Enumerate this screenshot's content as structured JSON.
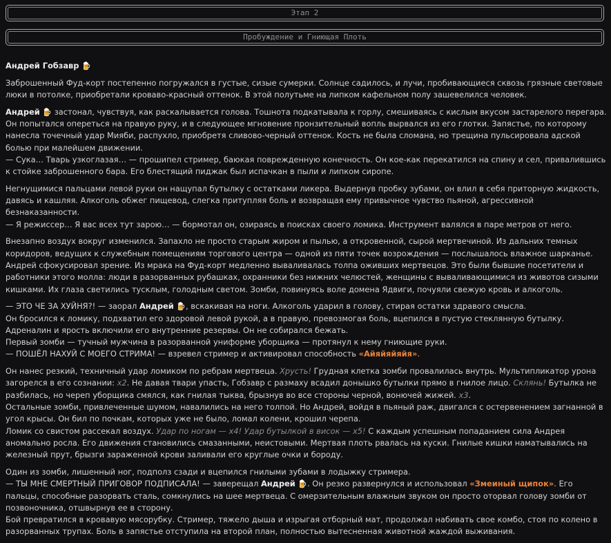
{
  "header": {
    "stage": "Этап 2",
    "chapter": "Пробуждение и Гниющая Плоть"
  },
  "author": {
    "name": "Андрей Гобзавр",
    "emoji": "🍺"
  },
  "hero": {
    "name": "Андрей",
    "emoji": "🍺"
  },
  "story": {
    "p1": "Заброшенный Фуд-корт постепенно погружался в густые, сизые сумерки. Солнце садилось, и лучи, пробивающиеся сквозь грязные световые люки в потолке, приобретали кроваво-красный оттенок. В этой полутьме на липком кафельном полу зашевелился человек.",
    "p2a": " застонал, чувствуя, как раскалывается голова. Тошнота подкатывала к горлу, смешиваясь с кислым вкусом застарелого перегара. Он попытался опереться на правую руку, и в следующее мгновение пронзительный вопль вырвался из его глотки. Запястье, по которому нанесла точечный удар Мияби, распухло, приобретя сливово-черный оттенок. Кость не была сломана, но трещина пульсировала адской болью при малейшем движении.",
    "p2b": "— Сука… Тварь узкоглазая… — прошипел стример, баюкая поврежденную конечность. Он кое-как перекатился на спину и сел, привалившись к стойке заброшенного бара. Его блестящий пиджак был испачкан в пыли и липком сиропе.",
    "p3a": "Негнущимися пальцами левой руки он нащупал бутылку с остатками ликера. Выдернув пробку зубами, он влил в себя приторную жидкость, давясь и кашляя. Алкоголь обжег пищевод, слегка притупляя боль и возвращая ему привычное чувство пьяной, агрессивной безнаказанности.",
    "p3b": "— Я режиссер… Я вас всех тут зарою… — бормотал он, озираясь в поисках своего ломика. Инструмент валялся в паре метров от него.",
    "p4a": "Внезапно воздух вокруг изменился. Запахло не просто старым жиром и пылью, а откровенной, сырой мертвечиной. Из дальних темных коридоров, ведущих к служебным помещениям торгового центра — одной из пяти точек возрождения — послышалось влажное шарканье.",
    "p4b": "Андрей сфокусировал зрение. Из мрака на Фуд-корт медленно вываливалась толпа оживших мертвецов. Это были бывшие посетители и работники этого молла: люди в разорванных рубашках, охранники без нижних челюстей, женщины с вываливающимися из животов сизыми кишками. Их глаза светились тусклым, голодным светом. Зомби, повинуясь воле домена Ядвиги, почуяли свежую кровь и алкоголь.",
    "p5a_pre": "— ЭТО ЧЕ ЗА ХУЙНЯ?! — заорал ",
    "p5a_post": ", вскакивая на ноги. Алкоголь ударил в голову, стирая остатки здравого смысла.",
    "p5b": "Он бросился к ломику, подхватил его здоровой левой рукой, а в правую, превозмогая боль, вцепился в пустую стеклянную бутылку. Адреналин и ярость включили его внутренние резервы. Он не собирался бежать.",
    "p5c": "Первый зомби — тучный мужчина в разорванной униформе уборщика — протянул к нему гниющие руки.",
    "p5d_pre": "— ПОШЁЛ НАХУЙ С МОЕГО СТРИМА! — взревел стример и активировал способность ",
    "p5d_skill": "«Айяйяйяйя»",
    "p5d_post": ".",
    "p6a_1": "Он нанес резкий, техничный удар ломиком по ребрам мертвеца. ",
    "p6a_sfx1": "Хрусть!",
    "p6a_2": " Грудная клетка зомби провалилась внутрь. Мультипликатор урона загорелся в его сознании: ",
    "p6a_sfx2": "x2",
    "p6a_3": ". Не давая твари упасть, Гобзавр с размаху всадил донышко бутылки прямо в гнилое лицо. ",
    "p6a_sfx3": "Склянь!",
    "p6a_4": " Бутылка не разбилась, но череп уборщика смялся, как гнилая тыква, брызнув во все стороны черной, вонючей жижей. ",
    "p6a_sfx4": "x3",
    "p6a_5": ".",
    "p6b": "Остальные зомби, привлеченные шумом, навалились на него толпой. Но Андрей, войдя в пьяный раж, двигался с остервенением загнанной в угол крысы. Он бил по почкам, которых уже не было, ломал колени, крошил черепа.",
    "p6c_1": "Ломик со свистом рассекал воздух. ",
    "p6c_sfx": "Удар по ногам — x4! Удар бутылкой в висок — x5!",
    "p6c_2": " С каждым успешным попаданием сила Андрея аномально росла. Его движения становились смазанными, неистовыми. Мертвая плоть рвалась на куски. Гнилые кишки наматывались на железный прут, брызги зараженной крови заливали его круглые очки и бороду.",
    "p7a": "Один из зомби, лишенный ног, подполз сзади и вцепился гнилыми зубами в лодыжку стримера.",
    "p7b_pre": "— ТЫ МНЕ СМЕРТНЫЙ ПРИГОВОР ПОДПИСАЛА! — заверещал ",
    "p7b_mid": ". Он резко развернулся и использовал ",
    "p7b_skill": "«Змеиный щипок»",
    "p7b_post": ". Его пальцы, способные разорвать сталь, сомкнулись на шее мертвеца. С омерзительным влажным звуком он просто оторвал голову зомби от позвоночника, отшвырнув ее в сторону.",
    "p7c": "Бой превратился в кровавую мясорубку. Стример, тяжело дыша и изрыгая отборный мат, продолжал набивать свое комбо, стоя по колено в разорванных трупах. Боль в запястье отступила на второй план, полностью вытесненная животной жаждой выживания."
  },
  "colors": {
    "background": "#101012",
    "text": "#d2d2d2",
    "skill": "#e8823a",
    "sfx": "#8e8e8e"
  }
}
